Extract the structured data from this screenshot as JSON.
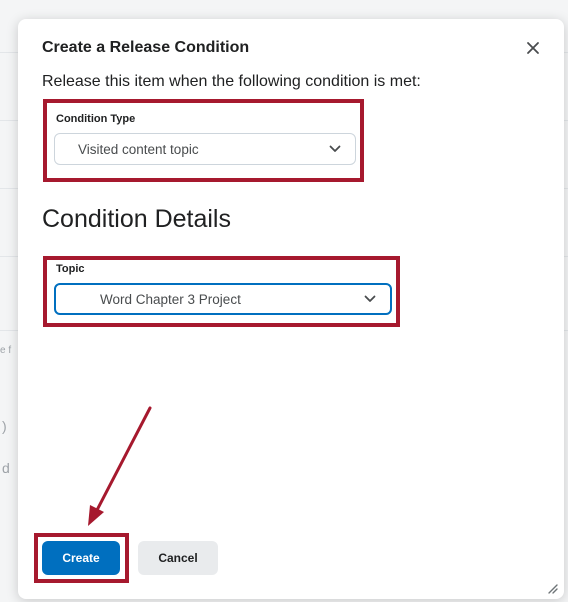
{
  "background": {
    "fragment_left_1": "e f",
    "fragment_left_2": ")",
    "fragment_left_3": "d"
  },
  "dialog": {
    "title": "Create a Release Condition",
    "close_icon": "close-icon",
    "instruction": "Release this item when the following condition is met:",
    "condition_type": {
      "label": "Condition Type",
      "value": "Visited content topic"
    },
    "section_heading": "Condition Details",
    "topic": {
      "label": "Topic",
      "value": "Word Chapter 3 Project"
    },
    "buttons": {
      "create": "Create",
      "cancel": "Cancel"
    }
  },
  "colors": {
    "accent": "#006fbf",
    "highlight": "#a6192e"
  }
}
